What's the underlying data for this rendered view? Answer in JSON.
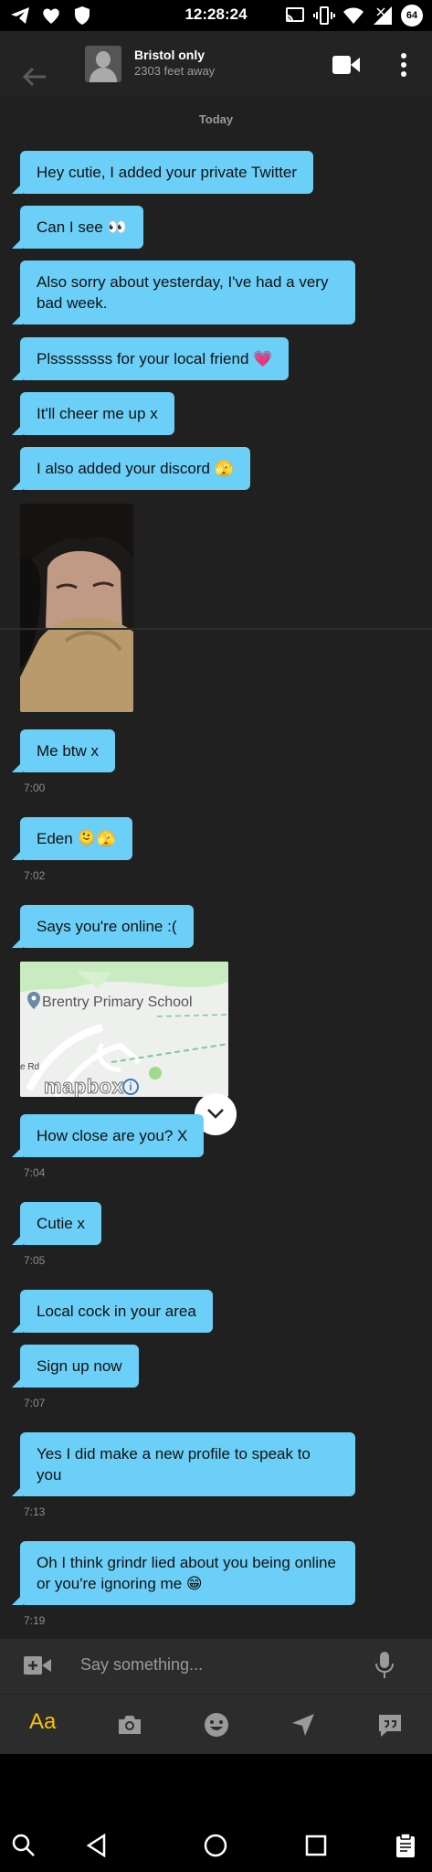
{
  "status_bar": {
    "time": "12:28:24",
    "battery": "64"
  },
  "header": {
    "name": "Bristol only",
    "distance": "2303 feet away"
  },
  "chat": {
    "date_label": "Today",
    "messages": [
      {
        "text": "Hey cutie, I added your private Twitter"
      },
      {
        "text": "Can I see 👀"
      },
      {
        "text": "Also sorry about yesterday, I've had a very bad week."
      },
      {
        "text": "Plssssssss for your local friend 💗"
      },
      {
        "text": "It'll cheer me up x"
      },
      {
        "text": "I also added your discord 🫣"
      },
      {
        "text": "Me btw x",
        "time": "7:00"
      },
      {
        "text": "Eden 🫠🫣",
        "time": "7:02"
      },
      {
        "text": "Says you're online :("
      },
      {
        "text": "How close are you?  X",
        "time": "7:04"
      },
      {
        "text": "Cutie x",
        "time": "7:05"
      },
      {
        "text": "Local cock in your area"
      },
      {
        "text": "Sign up now",
        "time": "7:07"
      },
      {
        "text": "Yes I did make a new profile to speak to you",
        "time": "7:13"
      },
      {
        "text": "Oh I think grindr lied about you being online or you're ignoring me 😁",
        "time": "7:19"
      }
    ],
    "map": {
      "place": "Brentry Primary School",
      "road": "e Rd",
      "brand": "mapbox",
      "info": "i"
    }
  },
  "input": {
    "placeholder": "Say something..."
  },
  "toolbar": {
    "text_style": "Aa"
  },
  "colors": {
    "bubble": "#6ccff8",
    "accent": "#f7c400",
    "background": "#202020"
  },
  "icons": [
    "telegram-icon",
    "heart-icon",
    "shield-icon",
    "cast-icon",
    "vibrate-icon",
    "wifi-icon",
    "signal-icon",
    "battery-icon",
    "back-arrow-icon",
    "video-call-icon",
    "more-icon",
    "chevron-down-icon",
    "add-video-icon",
    "mic-icon",
    "camera-icon",
    "emoji-icon",
    "location-icon",
    "quick-reply-icon",
    "search-icon",
    "nav-back-icon",
    "nav-home-icon",
    "nav-recents-icon",
    "clipboard-icon"
  ]
}
